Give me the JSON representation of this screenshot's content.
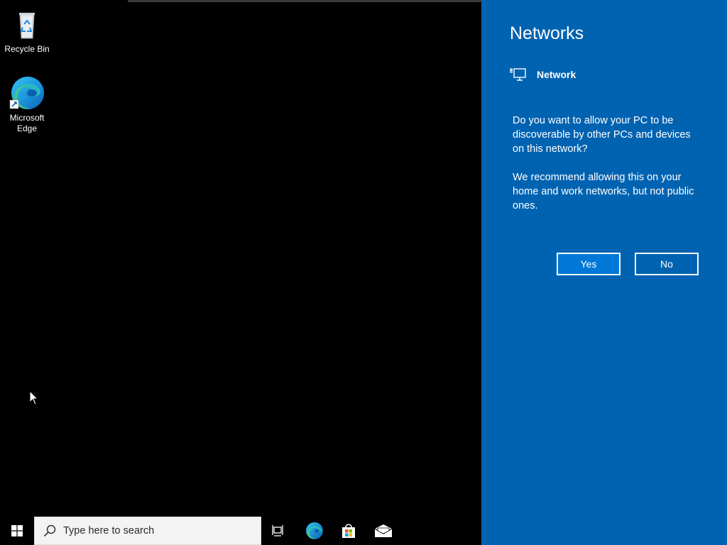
{
  "desktop": {
    "icons": [
      {
        "label": "Recycle Bin",
        "icon": "recycle-bin-icon"
      },
      {
        "label": "Microsoft\nEdge",
        "label_line1": "Microsoft",
        "label_line2": "Edge",
        "icon": "edge-icon"
      }
    ]
  },
  "flyout": {
    "title": "Networks",
    "network_name": "Network",
    "network_icon": "ethernet-icon",
    "question": "Do you want to allow your PC to be discoverable by other PCs and devices on this network?",
    "recommendation": "We recommend allowing this on your home and work networks, but not public ones.",
    "yes_label": "Yes",
    "no_label": "No",
    "background_color": "#0063b1",
    "yes_color": "#0078d7"
  },
  "taskbar": {
    "start_icon": "windows-logo-icon",
    "search_placeholder": "Type here to search",
    "search_icon": "search-icon",
    "pinned": [
      {
        "name": "task-view",
        "icon": "task-view-icon"
      },
      {
        "name": "microsoft-edge",
        "icon": "edge-icon"
      },
      {
        "name": "microsoft-store",
        "icon": "store-icon"
      },
      {
        "name": "mail",
        "icon": "mail-icon"
      }
    ]
  }
}
